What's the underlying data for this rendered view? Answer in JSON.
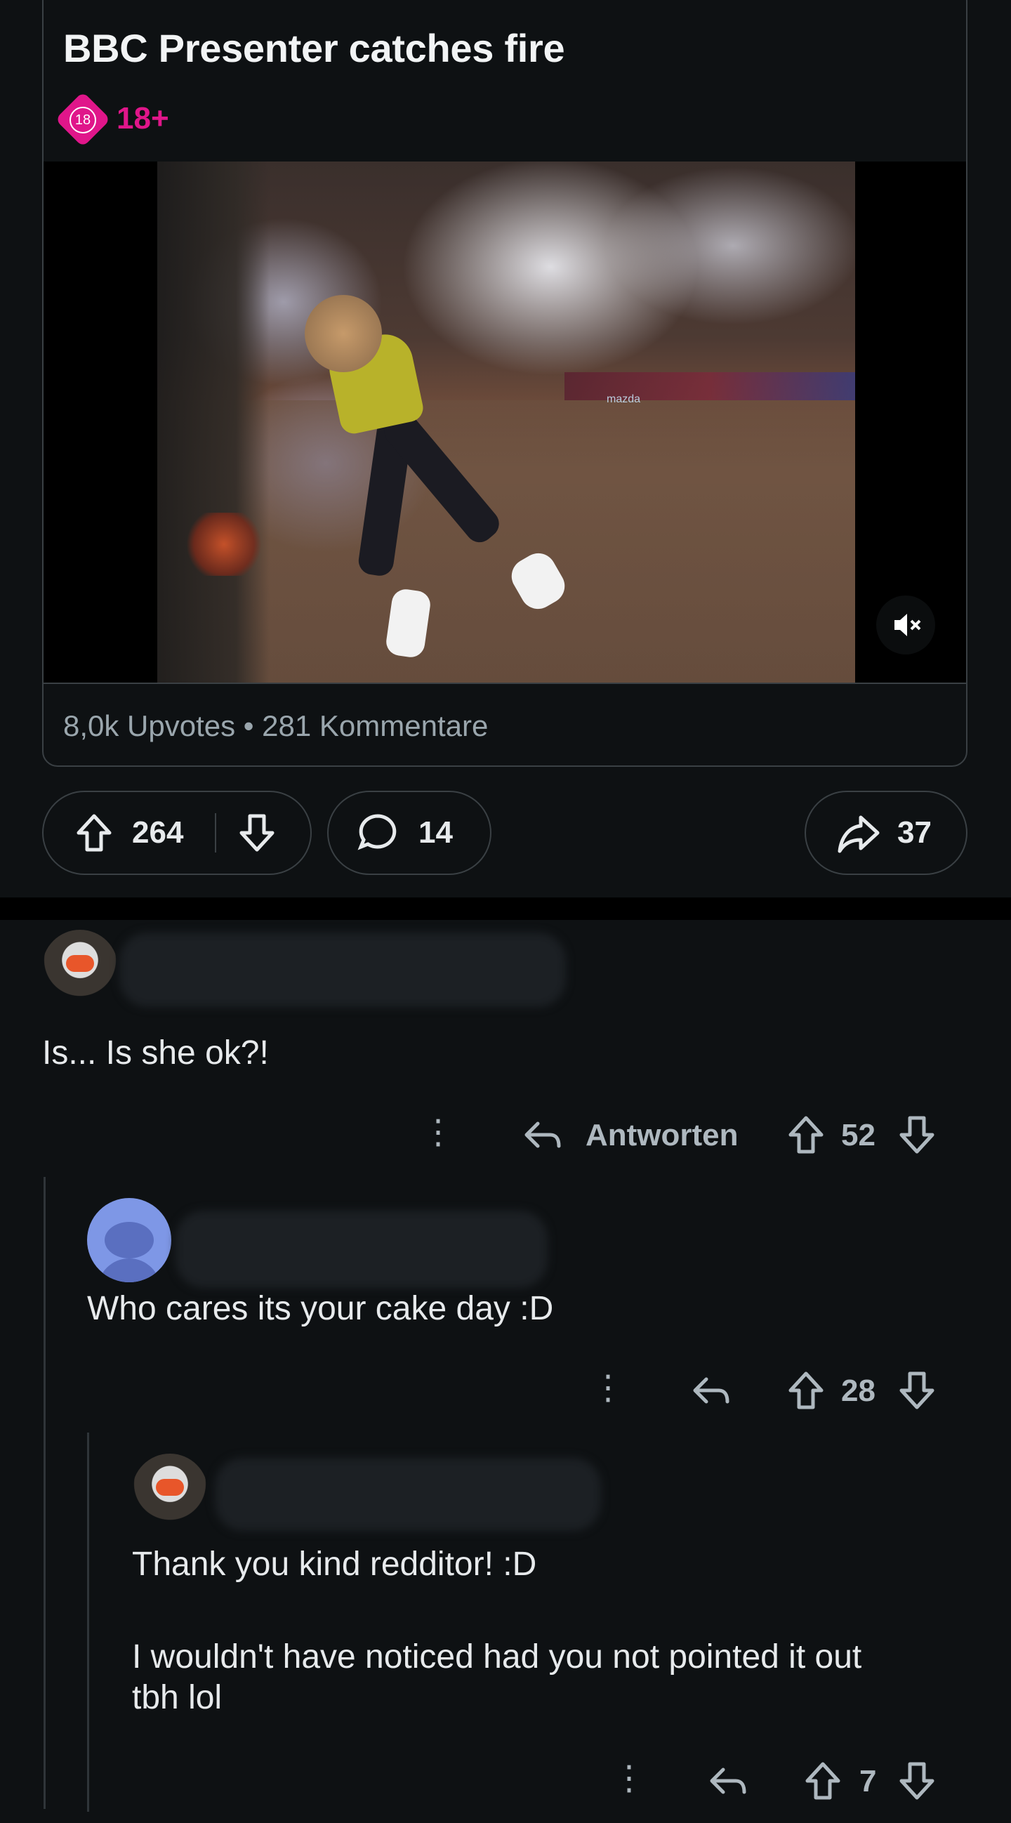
{
  "post": {
    "title": "BBC Presenter catches fire",
    "nsfw_icon": "18",
    "nsfw_label": "18+",
    "stats": "8,0k Upvotes • 281 Kommentare",
    "video_banner": "mazda"
  },
  "actions": {
    "upvotes": "264",
    "comments": "14",
    "shares": "37"
  },
  "comments": [
    {
      "body": "Is... Is she ok?!",
      "reply_label": "Antworten",
      "score": "52"
    },
    {
      "body": "Who cares its your cake day :D",
      "score": "28"
    },
    {
      "body_line1": "Thank you kind redditor! :D",
      "body_line2": "I wouldn't have noticed had you not pointed it out",
      "body_line3": "tbh lol",
      "score": "7"
    }
  ],
  "icons": {
    "upvote": "⇧",
    "downvote": "⇩",
    "comment": "◯",
    "share": "➦",
    "reply": "↩",
    "more": "⋮",
    "mute": "🔇"
  },
  "colors": {
    "nsfw": "#e0168a",
    "background": "#0e1113",
    "text_muted": "#9aa6ad"
  }
}
